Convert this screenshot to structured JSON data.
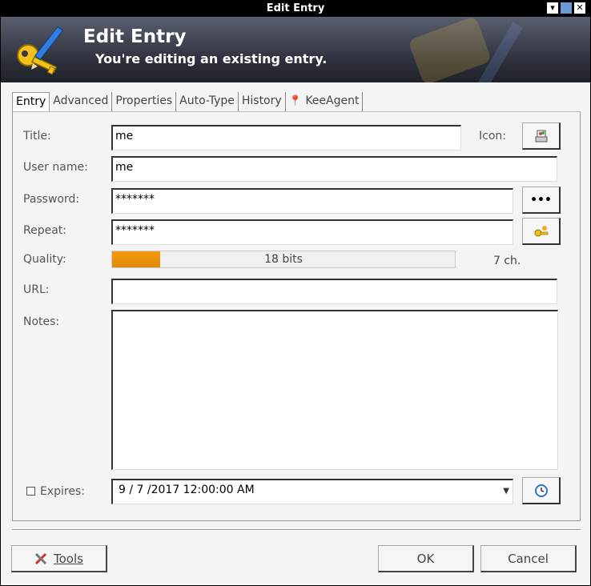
{
  "window": {
    "title": "Edit Entry",
    "buttons": [
      "▾",
      "",
      "✕"
    ]
  },
  "banner": {
    "title": "Edit Entry",
    "subtitle": "You're editing an existing entry."
  },
  "tabs": [
    {
      "label": "Entry"
    },
    {
      "label": "Advanced"
    },
    {
      "label": "Properties"
    },
    {
      "label": "Auto-Type"
    },
    {
      "label": "History"
    },
    {
      "label": "KeeAgent"
    }
  ],
  "form": {
    "title_label": "Title:",
    "title_value": "me",
    "icon_label": "Icon:",
    "username_label": "User name:",
    "username_value": "me",
    "password_label": "Password:",
    "password_value": "*******",
    "password_toggle": "•••",
    "repeat_label": "Repeat:",
    "repeat_value": "*******",
    "quality_label": "Quality:",
    "quality_text": "18 bits",
    "quality_fraction": 0.14,
    "char_count": "7 ch.",
    "url_label": "URL:",
    "url_value": "",
    "notes_label": "Notes:",
    "notes_value": "",
    "expires_label": "Expires:",
    "expires_value": "9 / 7 /2017  12:00:00  AM",
    "expires_checked": false
  },
  "footer": {
    "tools_label": "Tools",
    "ok_label": "OK",
    "cancel_label": "Cancel"
  },
  "colors": {
    "quality": "#f59a10",
    "banner": "#2c2f3a"
  }
}
